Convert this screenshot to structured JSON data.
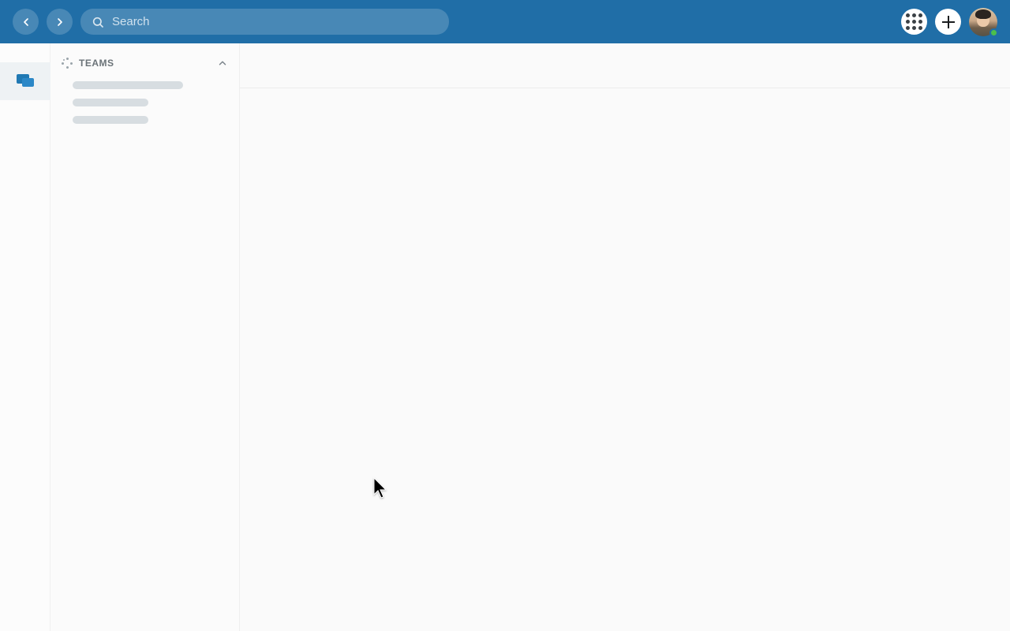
{
  "header": {
    "search_placeholder": "Search"
  },
  "sidebar": {
    "section_label": "TEAMS"
  },
  "icons": {
    "back": "chevron-left-icon",
    "forward": "chevron-right-icon",
    "search": "search-icon",
    "apps": "apps-grid-icon",
    "create": "plus-icon",
    "chat": "chat-bubbles-icon",
    "collapse": "chevron-up-icon",
    "loading": "loading-spinner-icon"
  },
  "presence": {
    "status": "online",
    "color": "#4cbf4c"
  },
  "colors": {
    "brand": "#206ea7"
  }
}
